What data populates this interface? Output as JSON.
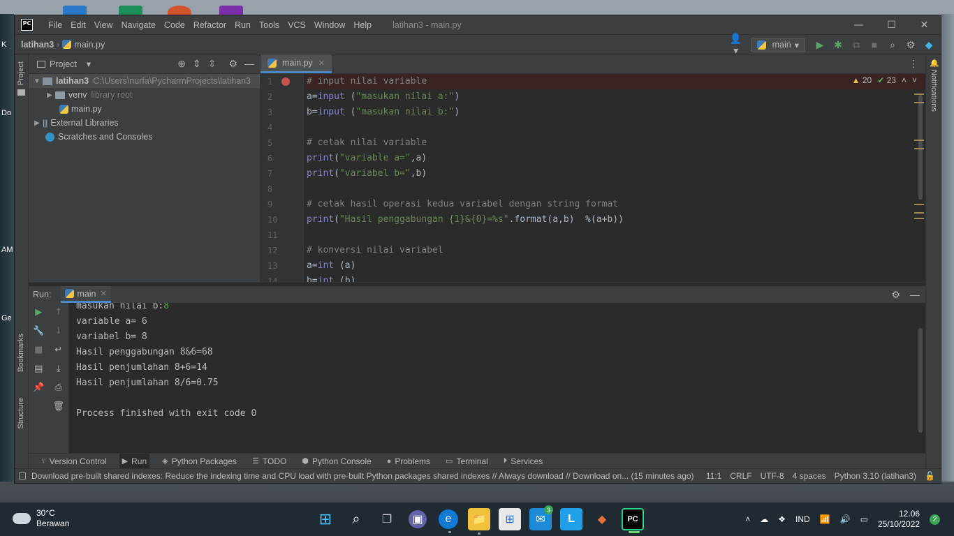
{
  "desktop": {
    "left_labels": [
      "K",
      "Do",
      "AM",
      "Ge"
    ]
  },
  "window": {
    "title": "latihan3 - main.py",
    "menu": [
      "File",
      "Edit",
      "View",
      "Navigate",
      "Code",
      "Refactor",
      "Run",
      "Tools",
      "VCS",
      "Window",
      "Help"
    ],
    "controls": [
      "—",
      "☐",
      "✕"
    ]
  },
  "navbar": {
    "project": "latihan3",
    "file": "main.py",
    "run_config": "main"
  },
  "project_panel": {
    "title": "Project",
    "root": {
      "name": "latihan3",
      "path": "C:\\Users\\nurfa\\PycharmProjects\\latihan3"
    },
    "venv": {
      "name": "venv",
      "note": "library root"
    },
    "file": "main.py",
    "external": "External Libraries",
    "scratches": "Scratches and Consoles"
  },
  "side_tabs": {
    "project": "Project",
    "bookmarks": "Bookmarks",
    "structure": "Structure",
    "notifications": "Notifications"
  },
  "editor": {
    "tab": "main.py",
    "warnings": "20",
    "ok": "23",
    "line_numbers": [
      "1",
      "2",
      "3",
      "4",
      "5",
      "6",
      "7",
      "8",
      "9",
      "10",
      "11",
      "12",
      "13",
      "14"
    ],
    "lines": [
      {
        "cls": "cmt",
        "text": "# input nilai variable"
      },
      {
        "parts": [
          [
            "",
            "a="
          ],
          [
            "fn",
            "input"
          ],
          [
            "",
            " ("
          ],
          [
            "str",
            "\"masukan nilai a:\""
          ],
          [
            "",
            ")"
          ]
        ]
      },
      {
        "parts": [
          [
            "",
            "b="
          ],
          [
            "fn",
            "input"
          ],
          [
            "",
            " ("
          ],
          [
            "str",
            "\"masukan nilai b:\""
          ],
          [
            "",
            ")"
          ]
        ]
      },
      {
        "text": ""
      },
      {
        "cls": "cmt",
        "text": "# cetak nilai variable"
      },
      {
        "parts": [
          [
            "fn",
            "print"
          ],
          [
            "",
            "("
          ],
          [
            "str",
            "\"variable a=\""
          ],
          [
            "",
            ",a)"
          ]
        ]
      },
      {
        "parts": [
          [
            "fn",
            "print"
          ],
          [
            "",
            "("
          ],
          [
            "str",
            "\"variabel b=\""
          ],
          [
            "",
            ",b)"
          ]
        ]
      },
      {
        "text": ""
      },
      {
        "cls": "cmt",
        "text": "# cetak hasil operasi kedua variabel dengan string format"
      },
      {
        "parts": [
          [
            "fn",
            "print"
          ],
          [
            "",
            "("
          ],
          [
            "str",
            "\"Hasil penggabungan {1}&{0}=%s\""
          ],
          [
            "",
            ".format(a,b)  %(a+b))"
          ]
        ]
      },
      {
        "text": ""
      },
      {
        "cls": "cmt",
        "text": "# konversi nilai variabel"
      },
      {
        "parts": [
          [
            "",
            "a="
          ],
          [
            "fn",
            "int"
          ],
          [
            "",
            " (a)"
          ]
        ]
      },
      {
        "parts": [
          [
            "",
            "b="
          ],
          [
            "fn",
            "int"
          ],
          [
            "",
            " (b)"
          ]
        ]
      }
    ]
  },
  "run": {
    "label": "Run:",
    "tab": "main",
    "prompt_text": "masukan nilai b:",
    "prompt_input": "8",
    "output": [
      "variable a= 6",
      "variabel b= 8",
      "Hasil penggabungan 8&6=68",
      "Hasil penjumlahan 8+6=14",
      "Hasil penjumlahan 8/6=0.75",
      "",
      "Process finished with exit code 0"
    ]
  },
  "bottom_tabs": [
    "Version Control",
    "Run",
    "Python Packages",
    "TODO",
    "Python Console",
    "Problems",
    "Terminal",
    "Services"
  ],
  "status": {
    "message": "Download pre-built shared indexes: Reduce the indexing time and CPU load with pre-built Python packages shared indexes // Always download // Download on... (15 minutes ago)",
    "position": "11:1",
    "line_sep": "CRLF",
    "encoding": "UTF-8",
    "indent": "4 spaces",
    "interpreter": "Python 3.10 (latihan3)"
  },
  "taskbar": {
    "temp": "30°C",
    "weather": "Berawan",
    "mail_badge": "3",
    "language": "IND",
    "time": "12.06",
    "date": "25/10/2022",
    "notifications": "2"
  }
}
